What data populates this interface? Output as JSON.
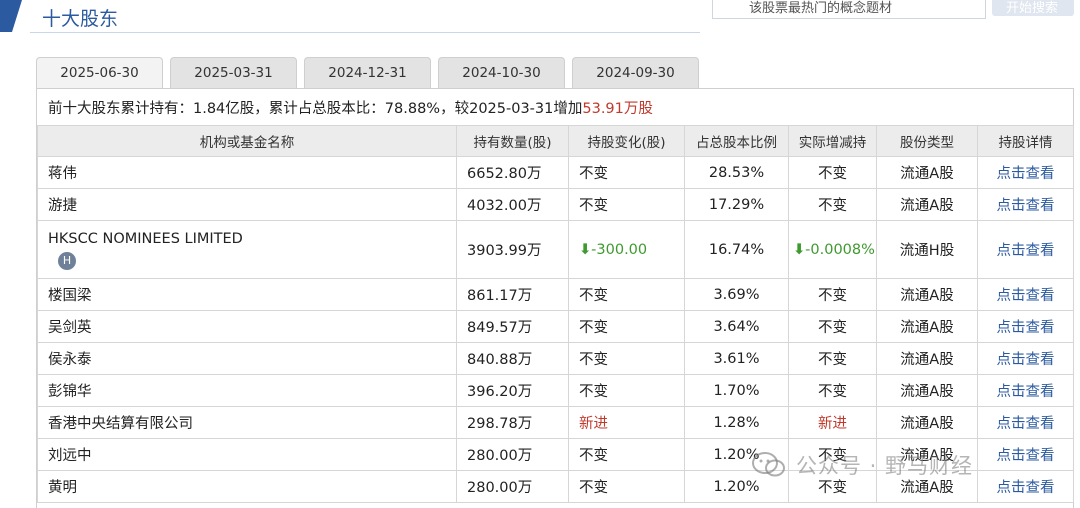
{
  "section": {
    "title": "十大股东"
  },
  "search": {
    "placeholder": "该股票最热门的概念题材",
    "button_label": "开始搜索"
  },
  "tabs": [
    {
      "label": "2025-06-30",
      "active": true
    },
    {
      "label": "2025-03-31",
      "active": false
    },
    {
      "label": "2024-12-31",
      "active": false
    },
    {
      "label": "2024-10-30",
      "active": false
    },
    {
      "label": "2024-09-30",
      "active": false
    }
  ],
  "summary": {
    "prefix": "前十大股东累计持有：",
    "total_shares": "1.84亿股",
    "ratio_label": "，累计占总股本比：",
    "ratio": "78.88%",
    "compare_label": "，较2025-03-31增加",
    "increase": "53.91万股"
  },
  "table": {
    "headers": [
      "机构或基金名称",
      "持有数量(股)",
      "持股变化(股)",
      "占总股本比例",
      "实际增减持",
      "股份类型",
      "持股详情"
    ],
    "rows": [
      {
        "name": "蒋伟",
        "qty": "6652.80万",
        "change": "不变",
        "change_style": "plain",
        "pct": "28.53%",
        "actual": "不变",
        "actual_style": "plain",
        "type": "流通A股",
        "detail": "点击查看"
      },
      {
        "name": "游捷",
        "qty": "4032.00万",
        "change": "不变",
        "change_style": "plain",
        "pct": "17.29%",
        "actual": "不变",
        "actual_style": "plain",
        "type": "流通A股",
        "detail": "点击查看"
      },
      {
        "name": "HKSCC NOMINEES LIMITED",
        "badge": "H",
        "qty": "3903.99万",
        "change": "-300.00",
        "change_style": "down",
        "pct": "16.74%",
        "actual": "-0.0008%",
        "actual_style": "down",
        "type": "流通H股",
        "detail": "点击查看"
      },
      {
        "name": "楼国梁",
        "qty": "861.17万",
        "change": "不变",
        "change_style": "plain",
        "pct": "3.69%",
        "actual": "不变",
        "actual_style": "plain",
        "type": "流通A股",
        "detail": "点击查看"
      },
      {
        "name": "吴剑英",
        "qty": "849.57万",
        "change": "不变",
        "change_style": "plain",
        "pct": "3.64%",
        "actual": "不变",
        "actual_style": "plain",
        "type": "流通A股",
        "detail": "点击查看"
      },
      {
        "name": "侯永泰",
        "qty": "840.88万",
        "change": "不变",
        "change_style": "plain",
        "pct": "3.61%",
        "actual": "不变",
        "actual_style": "plain",
        "type": "流通A股",
        "detail": "点击查看"
      },
      {
        "name": "彭锦华",
        "qty": "396.20万",
        "change": "不变",
        "change_style": "plain",
        "pct": "1.70%",
        "actual": "不变",
        "actual_style": "plain",
        "type": "流通A股",
        "detail": "点击查看"
      },
      {
        "name": "香港中央结算有限公司",
        "qty": "298.78万",
        "change": "新进",
        "change_style": "new",
        "pct": "1.28%",
        "actual": "新进",
        "actual_style": "new",
        "type": "流通A股",
        "detail": "点击查看"
      },
      {
        "name": "刘远中",
        "qty": "280.00万",
        "change": "不变",
        "change_style": "plain",
        "pct": "1.20%",
        "actual": "不变",
        "actual_style": "plain",
        "type": "流通A股",
        "detail": "点击查看"
      },
      {
        "name": "黄明",
        "qty": "280.00万",
        "change": "不变",
        "change_style": "plain",
        "pct": "1.20%",
        "actual": "不变",
        "actual_style": "plain",
        "type": "流通A股",
        "detail": "点击查看"
      }
    ]
  },
  "watermark": {
    "text": "公众号 · 野马财经"
  },
  "colors": {
    "accent": "#2b5aa0",
    "down": "#3e9a2f",
    "new": "#c0392b"
  },
  "icons": {
    "down_arrow": "arrow-down-icon",
    "hk_badge": "hk-badge-icon",
    "watermark": "wechat-icon"
  }
}
